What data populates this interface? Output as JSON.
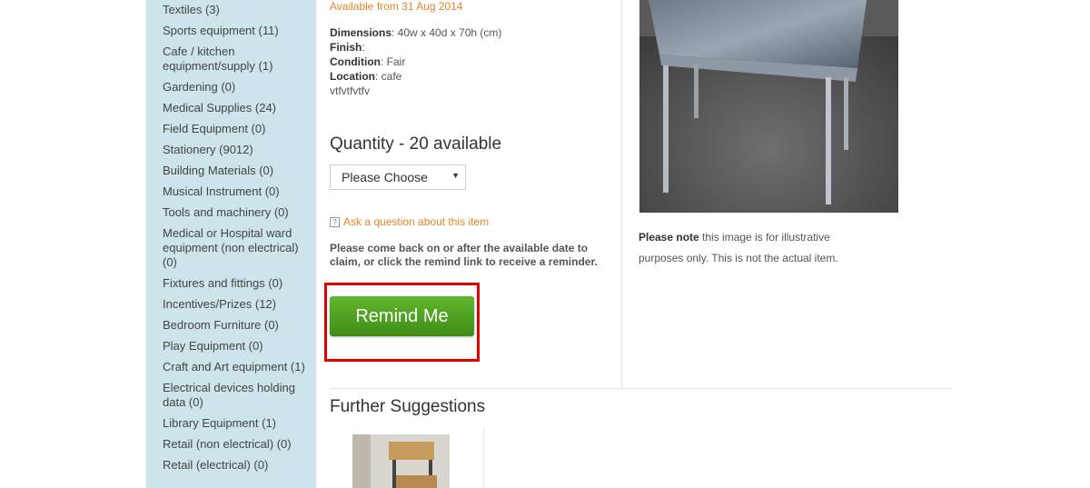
{
  "sidebar": {
    "items": [
      "Textiles (3)",
      "Sports equipment (11)",
      "Cafe / kitchen equipment/supply (1)",
      "Gardening (0)",
      "Medical Supplies (24)",
      "Field Equipment (0)",
      "Stationery (9012)",
      "Building Materials (0)",
      "Musical Instrument (0)",
      "Tools and machinery (0)",
      "Medical or Hospital ward equipment (non electrical) (0)",
      "Fixtures and fittings (0)",
      "Incentives/Prizes (12)",
      "Bedroom Furniture (0)",
      "Play Equipment (0)",
      "Craft and Art equipment (1)",
      "Electrical devices holding data (0)",
      "Library Equipment (1)",
      "Retail (non electrical) (0)",
      "Retail (electrical) (0)"
    ]
  },
  "item": {
    "available_from": "Available from 31 Aug 2014",
    "dimensions_label": "Dimensions",
    "dimensions_value": ": 40w x 40d x 70h (cm)",
    "finish_label": "Finish",
    "finish_value": ":",
    "condition_label": "Condition",
    "condition_value": ": Fair",
    "location_label": "Location",
    "location_value": ": cafe",
    "description": "vtfvtfvtfv"
  },
  "quantity": {
    "heading": "Quantity - 20 available",
    "select_value": "Please Choose"
  },
  "ask_link": "Ask a question about this item",
  "comeback_text": "Please come back on or after the available date to claim, or click the remind link to receive a reminder.",
  "remind_button": "Remind Me",
  "image_note": {
    "bold": "Please note",
    "rest": " this image is for illustrative purposes only. This is not the actual item."
  },
  "further_suggestions": "Further Suggestions",
  "colors": {
    "sidebar_bg": "#cce4ea",
    "accent_orange": "#e8832a",
    "button_green": "#4fa11f",
    "highlight_red": "#e00000"
  },
  "icons": {
    "ask": "question-box-icon",
    "select": "caret-down-icon"
  }
}
